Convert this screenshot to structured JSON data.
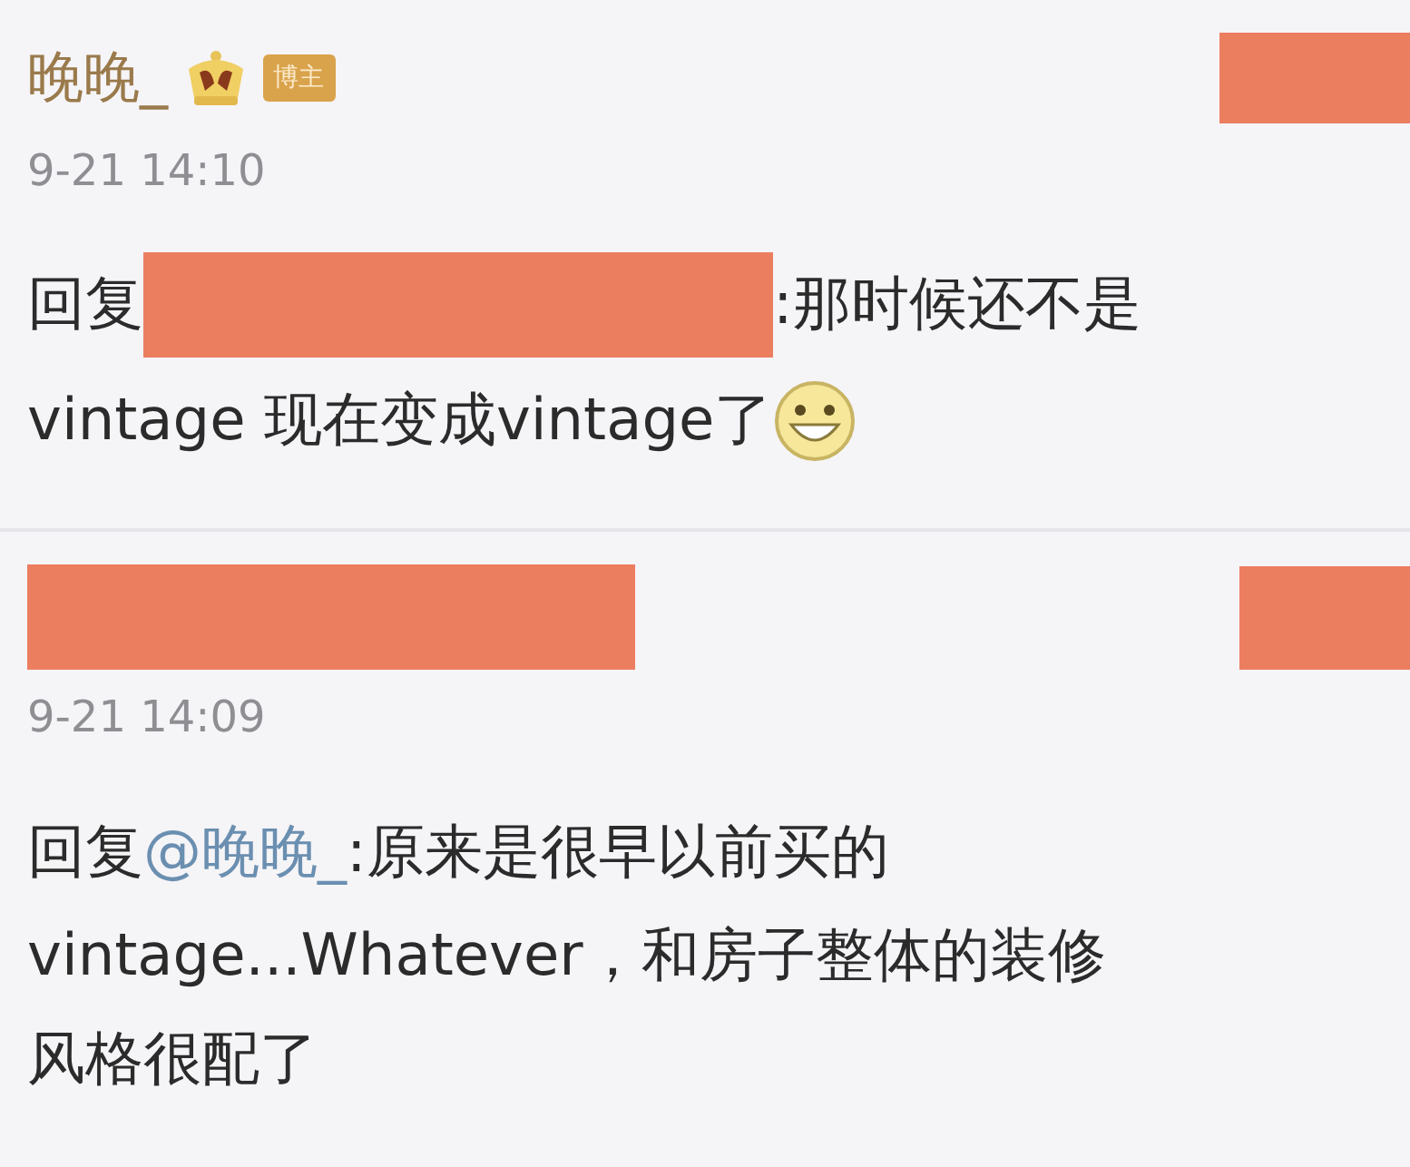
{
  "comments": [
    {
      "author": {
        "name": "晚晚_",
        "redacted": false,
        "crown": true,
        "badge": "博主"
      },
      "right_redacted": true,
      "time": "9-21 14:10",
      "lines": [
        [
          {
            "kind": "text",
            "text": "回复"
          },
          {
            "kind": "redacted"
          },
          {
            "kind": "text",
            "text": ":那时候还不是"
          }
        ],
        [
          {
            "kind": "text",
            "text": "vintage 现在变成vintage了"
          },
          {
            "kind": "emoji"
          }
        ]
      ]
    },
    {
      "author": {
        "redacted": true,
        "crown": false
      },
      "right_redacted": true,
      "time": "9-21 14:09",
      "lines": [
        [
          {
            "kind": "text",
            "text": "回复"
          },
          {
            "kind": "mention",
            "text": "@晚晚_"
          },
          {
            "kind": "text",
            "text": ":原来是很早以前买的"
          }
        ],
        [
          {
            "kind": "text",
            "text": "vintage...Whatever，和房子整体的装修"
          }
        ],
        [
          {
            "kind": "text",
            "text": "风格很配了"
          }
        ]
      ]
    }
  ]
}
